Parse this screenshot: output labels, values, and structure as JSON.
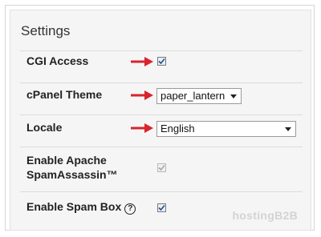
{
  "settings": {
    "title": "Settings",
    "rows": {
      "cgi": {
        "label": "CGI Access",
        "checked": true,
        "enabled": true
      },
      "theme": {
        "label": "cPanel Theme",
        "value": "paper_lantern"
      },
      "locale": {
        "label": "Locale",
        "value": "English"
      },
      "spamassassin": {
        "label_line1": "Enable Apache",
        "label_line2": "SpamAssassin™",
        "checked": true,
        "enabled": false
      },
      "spambox": {
        "label": "Enable Spam Box",
        "help": "?",
        "checked": true,
        "enabled": true
      }
    }
  },
  "watermark": "hostingB2B",
  "colors": {
    "arrow": "#d9232d",
    "check": "#2b4f8a"
  }
}
